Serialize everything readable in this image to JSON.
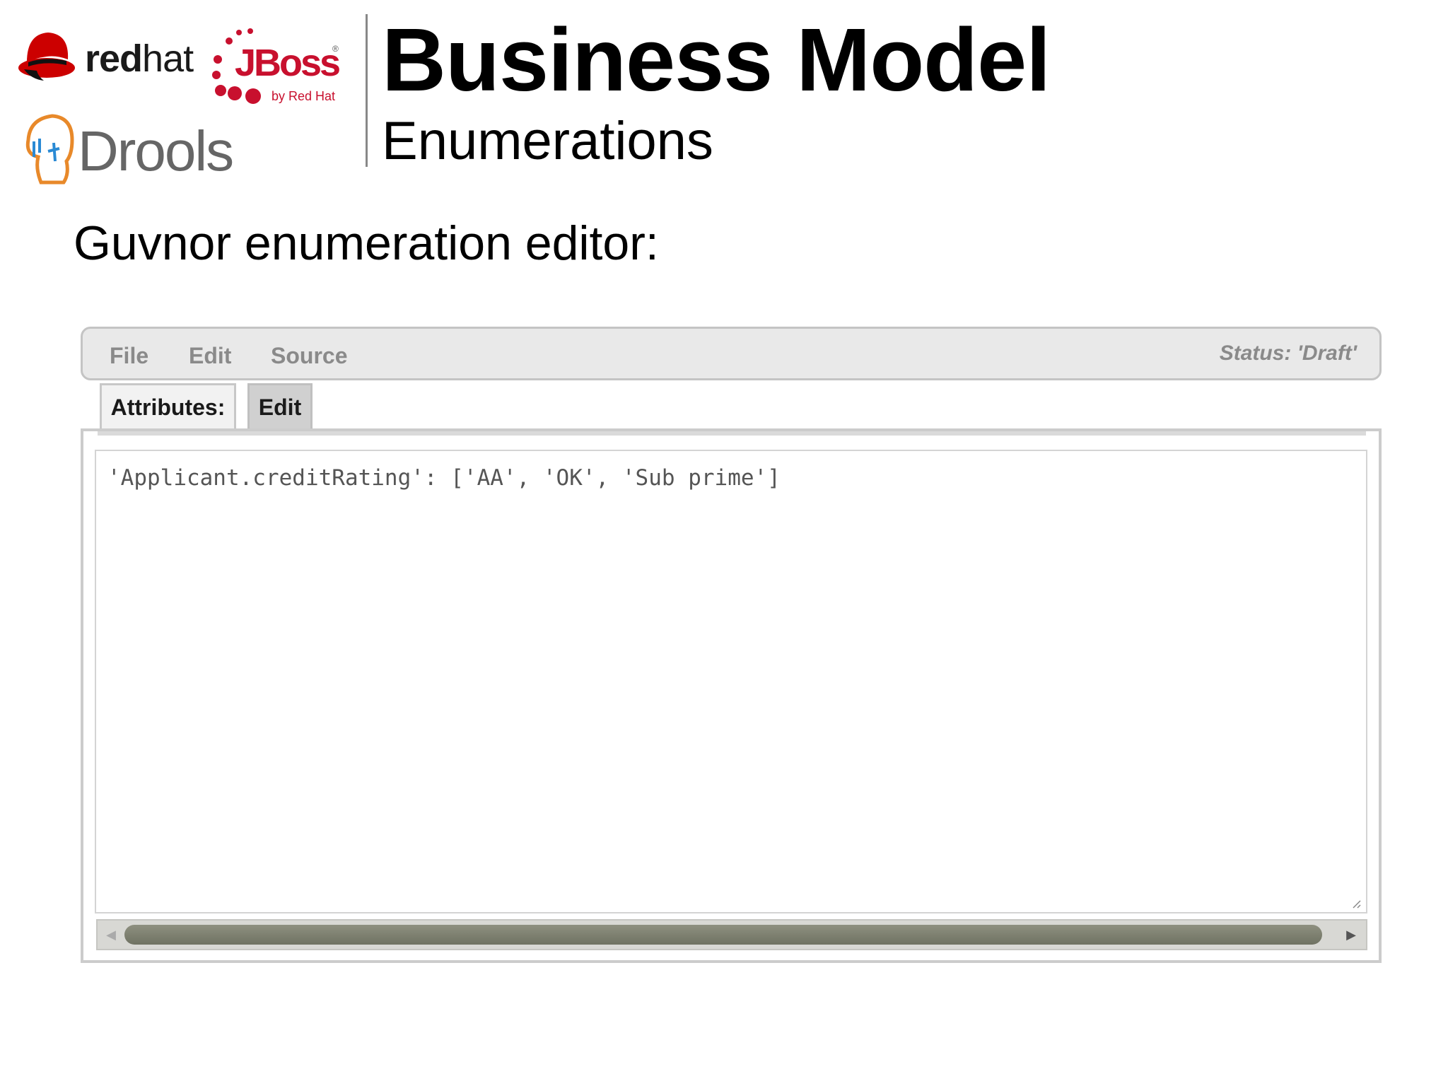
{
  "logos": {
    "redhat_text_bold": "red",
    "redhat_text_light": "hat",
    "jboss_text": "JBoss",
    "jboss_registered": "®",
    "jboss_byline": "by Red Hat",
    "drools_text": "Drools"
  },
  "header": {
    "title": "Business Model",
    "subtitle": "Enumerations"
  },
  "section": {
    "heading": "Guvnor enumeration editor:"
  },
  "editor": {
    "menu": {
      "file_label": "File",
      "edit_label": "Edit",
      "source_label": "Source"
    },
    "status": "Status: 'Draft'",
    "tabs": {
      "attributes_label": "Attributes:",
      "edit_label": "Edit"
    },
    "content": "'Applicant.creditRating': ['AA', 'OK', 'Sub prime']",
    "scroll": {
      "left_arrow": "◀",
      "right_arrow": "▶"
    }
  },
  "colors": {
    "redhat_red": "#cc0000",
    "jboss_red": "#c8102e",
    "drools_orange": "#e8892a",
    "drools_blue": "#2a8ad4",
    "menu_text": "#8a8a8a",
    "scroll_thumb": "#7a7d6c"
  },
  "icons": [
    "redhat-shadowman-icon",
    "jboss-dots-icon",
    "drools-head-icon",
    "resize-grip-icon"
  ]
}
